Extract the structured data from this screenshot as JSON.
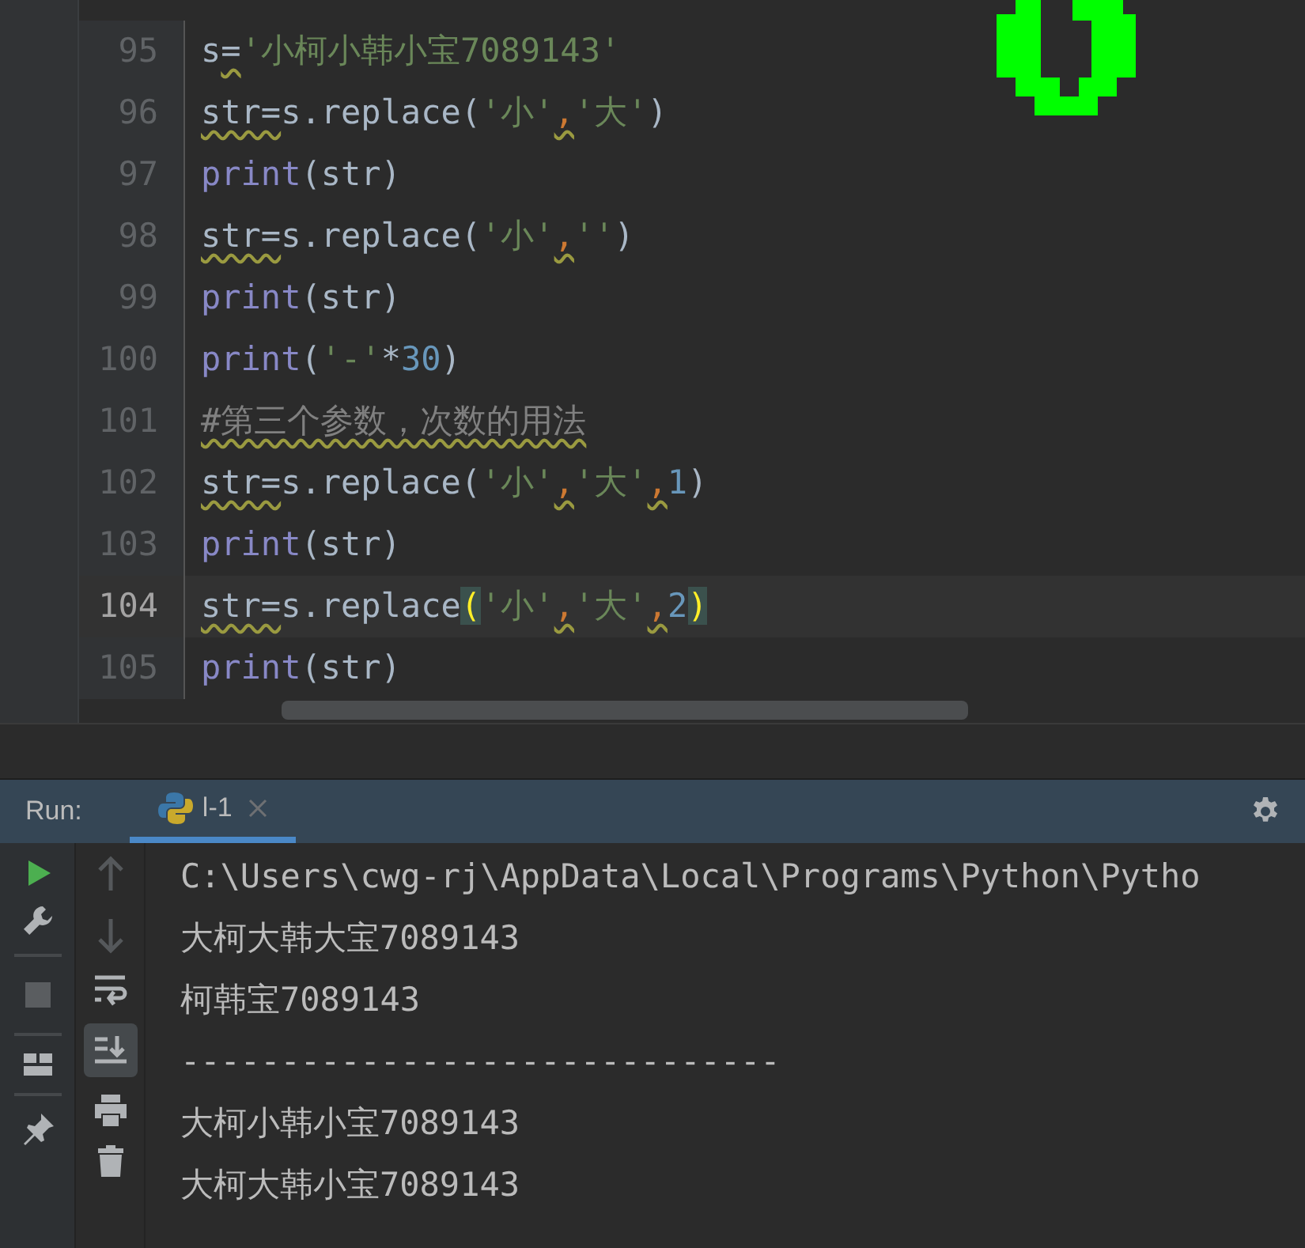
{
  "editor": {
    "lines": [
      {
        "number": "95",
        "current": false,
        "tokens": [
          {
            "text": "s",
            "kind": "plain"
          },
          {
            "text": "=",
            "kind": "plain_warn"
          },
          {
            "text": "'小柯小韩小宝7089143'",
            "kind": "string"
          }
        ]
      },
      {
        "number": "96",
        "current": false,
        "tokens": [
          {
            "text": "str=",
            "kind": "plain_warn"
          },
          {
            "text": "s.replace(",
            "kind": "plain"
          },
          {
            "text": "'小'",
            "kind": "string"
          },
          {
            "text": ",",
            "kind": "comma_warn"
          },
          {
            "text": "'大'",
            "kind": "string"
          },
          {
            "text": ")",
            "kind": "plain"
          }
        ]
      },
      {
        "number": "97",
        "current": false,
        "tokens": [
          {
            "text": "print",
            "kind": "builtin"
          },
          {
            "text": "(str)",
            "kind": "plain"
          }
        ]
      },
      {
        "number": "98",
        "current": false,
        "tokens": [
          {
            "text": "str=",
            "kind": "plain_warn"
          },
          {
            "text": "s.replace(",
            "kind": "plain"
          },
          {
            "text": "'小'",
            "kind": "string"
          },
          {
            "text": ",",
            "kind": "comma_warn"
          },
          {
            "text": "''",
            "kind": "string"
          },
          {
            "text": ")",
            "kind": "plain"
          }
        ]
      },
      {
        "number": "99",
        "current": false,
        "tokens": [
          {
            "text": "print",
            "kind": "builtin"
          },
          {
            "text": "(str)",
            "kind": "plain"
          }
        ]
      },
      {
        "number": "100",
        "current": false,
        "tokens": [
          {
            "text": "print",
            "kind": "builtin"
          },
          {
            "text": "(",
            "kind": "plain"
          },
          {
            "text": "'-'",
            "kind": "string"
          },
          {
            "text": "*",
            "kind": "plain"
          },
          {
            "text": "30",
            "kind": "number"
          },
          {
            "text": ")",
            "kind": "plain"
          }
        ]
      },
      {
        "number": "101",
        "current": false,
        "tokens": [
          {
            "text": "#第三个参数，次数的用法",
            "kind": "comment_warn"
          }
        ]
      },
      {
        "number": "102",
        "current": false,
        "tokens": [
          {
            "text": "str=",
            "kind": "plain_warn"
          },
          {
            "text": "s.replace(",
            "kind": "plain"
          },
          {
            "text": "'小'",
            "kind": "string"
          },
          {
            "text": ",",
            "kind": "comma_warn"
          },
          {
            "text": "'大'",
            "kind": "string"
          },
          {
            "text": ",",
            "kind": "comma_warn"
          },
          {
            "text": "1",
            "kind": "number"
          },
          {
            "text": ")",
            "kind": "plain"
          }
        ]
      },
      {
        "number": "103",
        "current": false,
        "tokens": [
          {
            "text": "print",
            "kind": "builtin"
          },
          {
            "text": "(str)",
            "kind": "plain"
          }
        ]
      },
      {
        "number": "104",
        "current": true,
        "tokens": [
          {
            "text": "str=",
            "kind": "plain_warn"
          },
          {
            "text": "s.replace",
            "kind": "plain"
          },
          {
            "text": "(",
            "kind": "bracket_match"
          },
          {
            "text": "'小'",
            "kind": "string"
          },
          {
            "text": ",",
            "kind": "comma_warn"
          },
          {
            "text": "'大'",
            "kind": "string"
          },
          {
            "text": ",",
            "kind": "comma_warn"
          },
          {
            "text": "2",
            "kind": "number"
          },
          {
            "text": ")",
            "kind": "bracket_match"
          }
        ]
      },
      {
        "number": "105",
        "current": false,
        "tokens": [
          {
            "text": "print",
            "kind": "builtin"
          },
          {
            "text": "(str)",
            "kind": "plain"
          }
        ]
      }
    ]
  },
  "run_panel": {
    "label": "Run:",
    "tabs": [
      {
        "label": "l-1",
        "selected": true
      }
    ],
    "output": [
      "C:\\Users\\cwg-rj\\AppData\\Local\\Programs\\Python\\Pytho",
      "大柯大韩大宝7089143",
      "柯韩宝7089143",
      "------------------------------",
      "大柯小韩小宝7089143",
      "大柯大韩小宝7089143"
    ]
  }
}
